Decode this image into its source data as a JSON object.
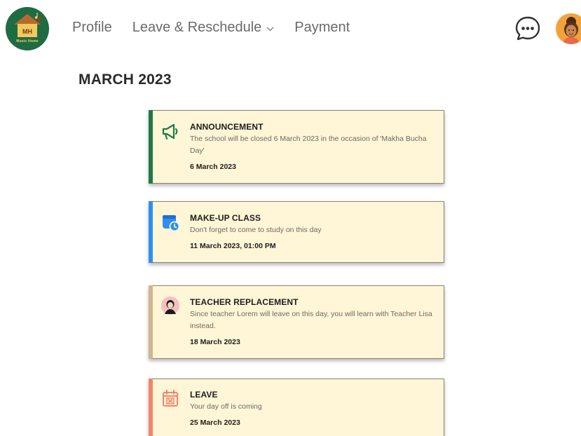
{
  "header": {
    "logo_text": "MH",
    "logo_subtext": "Music Home",
    "nav": [
      {
        "label": "Profile"
      },
      {
        "label": "Leave & Reschedule"
      },
      {
        "label": "Payment"
      }
    ]
  },
  "page": {
    "title": "MARCH 2023"
  },
  "cards": [
    {
      "title": "ANNOUNCEMENT",
      "description": "The school will be closed 6 March 2023 in the occasion of  'Makha Bucha Day'",
      "date": "6 March 2023",
      "accent": "#1f7a4a",
      "icon": "megaphone-icon"
    },
    {
      "title": "MAKE-UP CLASS",
      "description": "Don't forget to come to study on this day",
      "date": "11 March 2023, 01:00 PM",
      "accent": "#2f8ff0",
      "icon": "calendar-clock-icon"
    },
    {
      "title": "TEACHER REPLACEMENT",
      "description": "Since teacher Lorem will leave on this day, you will learn with Teacher Lisa instead.",
      "date": "18 March 2023",
      "accent": "#cfb68d",
      "icon": "teacher-icon"
    },
    {
      "title": "LEAVE",
      "description": "Your day off is coming",
      "date": "25 March 2023",
      "accent": "#f2846b",
      "icon": "calendar-x-icon"
    }
  ]
}
